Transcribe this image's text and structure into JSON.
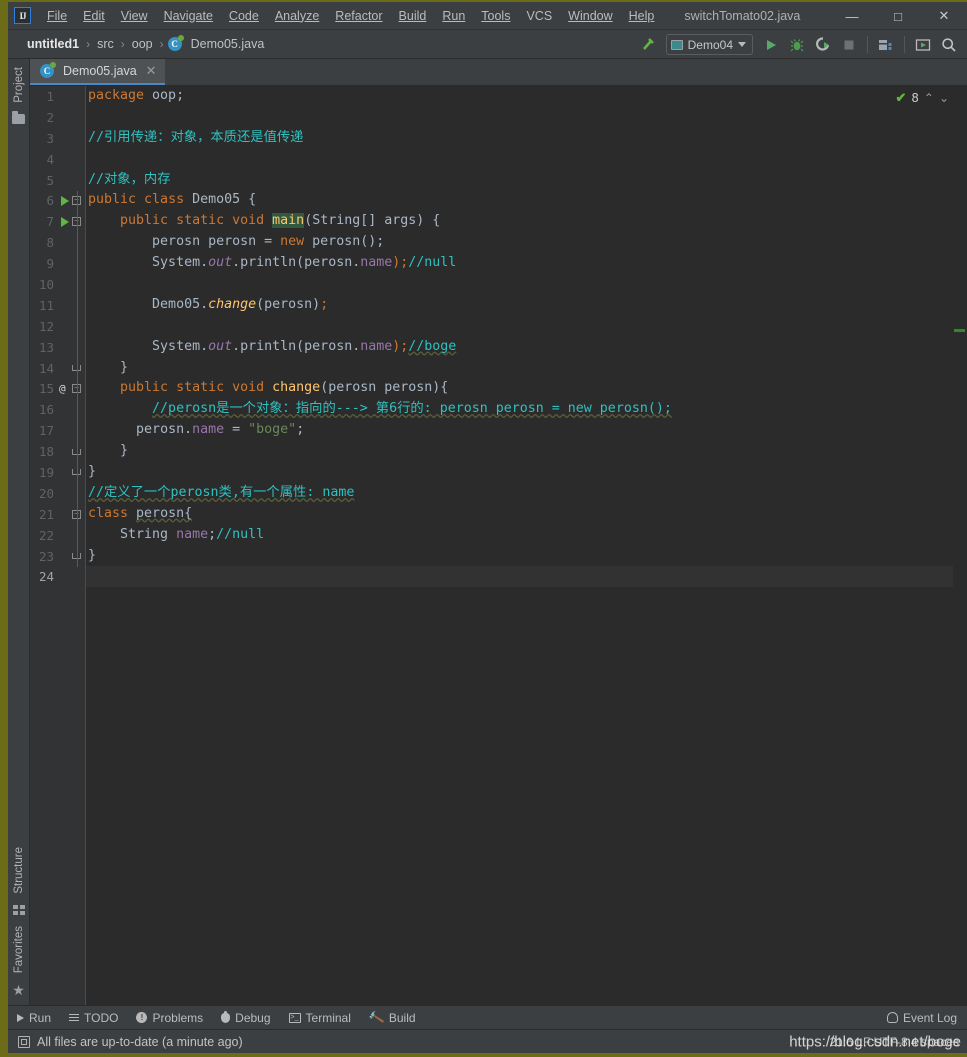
{
  "window": {
    "title": "switchTomato02.java",
    "logo_text": "IJ",
    "minimize": "—",
    "maximize": "□",
    "close": "✕"
  },
  "menu": [
    {
      "label": "File",
      "mnemonic": "F"
    },
    {
      "label": "Edit",
      "mnemonic": "E"
    },
    {
      "label": "View",
      "mnemonic": "V"
    },
    {
      "label": "Navigate",
      "mnemonic": "N"
    },
    {
      "label": "Code",
      "mnemonic": "C"
    },
    {
      "label": "Analyze",
      "mnemonic": "z"
    },
    {
      "label": "Refactor",
      "mnemonic": "R"
    },
    {
      "label": "Build",
      "mnemonic": "B"
    },
    {
      "label": "Run",
      "mnemonic": "u"
    },
    {
      "label": "Tools",
      "mnemonic": "T"
    },
    {
      "label": "VCS",
      "mnemonic": ""
    },
    {
      "label": "Window",
      "mnemonic": "W"
    },
    {
      "label": "Help",
      "mnemonic": "H"
    }
  ],
  "breadcrumb": {
    "items": [
      "untitled1",
      "src",
      "oop",
      "Demo05.java"
    ],
    "separator": "›",
    "file_icon": "class-icon",
    "class_letter": "C"
  },
  "toolbar": {
    "build_icon": "hammer-icon",
    "run_config": "Demo04",
    "run_icon": "run-icon",
    "debug_icon": "debug-icon",
    "coverage_icon": "run-with-coverage-icon",
    "stop_icon": "stop-icon",
    "project_structure_icon": "project-structure-icon",
    "updates_icon": "updates-icon",
    "search_icon": "search-everywhere-icon"
  },
  "left_strip": {
    "top": [
      {
        "label": "Project",
        "icon": "folder-icon"
      }
    ],
    "bottom": [
      {
        "label": "Structure",
        "icon": "structure-icon"
      },
      {
        "label": "Favorites",
        "icon": "star-icon"
      }
    ]
  },
  "tabs": [
    {
      "label": "Demo05.java",
      "icon": "class-icon",
      "close": "✕",
      "active": true
    }
  ],
  "inspection": {
    "status_icon": "check-ok-icon",
    "count": "8",
    "prev_icon": "⌃",
    "next_icon": "⌄"
  },
  "editor": {
    "current_line": 24,
    "lines": [
      {
        "n": 1,
        "gutter": {},
        "tokens": [
          {
            "t": "package ",
            "c": "kw"
          },
          {
            "t": "oop;",
            "c": ""
          }
        ],
        "indent": 0
      },
      {
        "n": 2,
        "gutter": {},
        "tokens": [],
        "indent": 0
      },
      {
        "n": 3,
        "gutter": {},
        "tokens": [
          {
            "t": "//引用传递：对象，本质还是值传递",
            "c": "cmt"
          }
        ],
        "indent": 0
      },
      {
        "n": 4,
        "gutter": {},
        "tokens": [],
        "indent": 0
      },
      {
        "n": 5,
        "gutter": {},
        "tokens": [
          {
            "t": "//对象，内存",
            "c": "cmt"
          }
        ],
        "indent": 0
      },
      {
        "n": 6,
        "gutter": {
          "run": true,
          "fold": "open"
        },
        "tokens": [
          {
            "t": "public ",
            "c": "kw"
          },
          {
            "t": "class ",
            "c": "kw"
          },
          {
            "t": "Demo05 {",
            "c": ""
          }
        ],
        "indent": 0
      },
      {
        "n": 7,
        "gutter": {
          "run": true,
          "fold": "open"
        },
        "tokens": [
          {
            "t": "public ",
            "c": "kw"
          },
          {
            "t": "static ",
            "c": "kw"
          },
          {
            "t": "void ",
            "c": "kw"
          },
          {
            "t": "main",
            "c": "hl"
          },
          {
            "t": "(String[] args) {",
            "c": ""
          }
        ],
        "indent": 1
      },
      {
        "n": 8,
        "gutter": {},
        "tokens": [
          {
            "t": "perosn perosn = ",
            "c": ""
          },
          {
            "t": "new ",
            "c": "kw"
          },
          {
            "t": "perosn();",
            "c": ""
          }
        ],
        "indent": 2
      },
      {
        "n": 9,
        "gutter": {},
        "tokens": [
          {
            "t": "System.",
            "c": ""
          },
          {
            "t": "out",
            "c": "sfld"
          },
          {
            "t": ".println(perosn.",
            "c": ""
          },
          {
            "t": "name",
            "c": "fld"
          },
          {
            "t": ");",
            "c": "kw"
          },
          {
            "t": "//null",
            "c": "cmt"
          }
        ],
        "indent": 2
      },
      {
        "n": 10,
        "gutter": {},
        "tokens": [],
        "indent": 0
      },
      {
        "n": 11,
        "gutter": {},
        "tokens": [
          {
            "t": "Demo05.",
            "c": ""
          },
          {
            "t": "change",
            "c": "smth"
          },
          {
            "t": "(perosn)",
            "c": ""
          },
          {
            "t": ";",
            "c": "kw"
          }
        ],
        "indent": 2
      },
      {
        "n": 12,
        "gutter": {},
        "tokens": [],
        "indent": 0
      },
      {
        "n": 13,
        "gutter": {},
        "tokens": [
          {
            "t": "System.",
            "c": ""
          },
          {
            "t": "out",
            "c": "sfld"
          },
          {
            "t": ".println(perosn.",
            "c": ""
          },
          {
            "t": "name",
            "c": "fld"
          },
          {
            "t": ");",
            "c": "kw"
          },
          {
            "t": "//boge",
            "c": "cmt-u"
          }
        ],
        "indent": 2
      },
      {
        "n": 14,
        "gutter": {
          "fold": "end"
        },
        "tokens": [
          {
            "t": "}",
            "c": ""
          }
        ],
        "indent": 1
      },
      {
        "n": 15,
        "gutter": {
          "at": "@",
          "fold": "open"
        },
        "tokens": [
          {
            "t": "public ",
            "c": "kw"
          },
          {
            "t": "static ",
            "c": "kw"
          },
          {
            "t": "void ",
            "c": "kw"
          },
          {
            "t": "change",
            "c": "mth"
          },
          {
            "t": "(perosn perosn){",
            "c": ""
          }
        ],
        "indent": 1
      },
      {
        "n": 16,
        "gutter": {},
        "tokens": [
          {
            "t": "//perosn是一个对象：指向的---> 第6行的: perosn perosn = new perosn();",
            "c": "cmt-u"
          }
        ],
        "indent": 2
      },
      {
        "n": 17,
        "gutter": {},
        "tokens": [
          {
            "t": "perosn.",
            "c": ""
          },
          {
            "t": "name",
            "c": "fld"
          },
          {
            "t": " = ",
            "c": ""
          },
          {
            "t": "\"boge\"",
            "c": "str"
          },
          {
            "t": ";",
            "c": ""
          }
        ],
        "indent": 1.5
      },
      {
        "n": 18,
        "gutter": {
          "fold": "end"
        },
        "tokens": [
          {
            "t": "}",
            "c": ""
          }
        ],
        "indent": 1
      },
      {
        "n": 19,
        "gutter": {
          "fold": "end"
        },
        "tokens": [
          {
            "t": "}",
            "c": ""
          }
        ],
        "indent": 0
      },
      {
        "n": 20,
        "gutter": {},
        "tokens": [
          {
            "t": "//定义了一个perosn类,有一个属性: name",
            "c": "cmt-u"
          }
        ],
        "indent": 0
      },
      {
        "n": 21,
        "gutter": {
          "fold": "open"
        },
        "tokens": [
          {
            "t": "class ",
            "c": "kw"
          },
          {
            "t": "perosn{",
            "c": "typo"
          }
        ],
        "indent": 0
      },
      {
        "n": 22,
        "gutter": {},
        "tokens": [
          {
            "t": "String ",
            "c": ""
          },
          {
            "t": "name",
            "c": "fld"
          },
          {
            "t": ";",
            "c": ""
          },
          {
            "t": "//null",
            "c": "cmt"
          }
        ],
        "indent": 1
      },
      {
        "n": 23,
        "gutter": {
          "fold": "end"
        },
        "tokens": [
          {
            "t": "}",
            "c": ""
          }
        ],
        "indent": 0
      },
      {
        "n": 24,
        "gutter": {},
        "tokens": [],
        "indent": 0
      }
    ]
  },
  "tool_windows": [
    {
      "label": "Run",
      "icon": "run-icon"
    },
    {
      "label": "TODO",
      "icon": "todo-icon"
    },
    {
      "label": "Problems",
      "icon": "problems-icon"
    },
    {
      "label": "Debug",
      "icon": "debug-icon"
    },
    {
      "label": "Terminal",
      "icon": "terminal-icon"
    },
    {
      "label": "Build",
      "icon": "build-icon"
    }
  ],
  "event_log": {
    "label": "Event Log",
    "icon": "event-log-icon"
  },
  "status": {
    "message": "All files are up-to-date (a minute ago)",
    "icon": "sync-icon",
    "right_text": "21:6  LF  UTF-8  4 spaces",
    "watermark": "https://blog.csdn.net/boge"
  },
  "colors": {
    "accent_blue": "#4a88c7",
    "keyword_orange": "#cc7832",
    "comment_cyan": "#30c0c0",
    "string_green": "#6a8759",
    "field_purple": "#9876aa",
    "method_yellow": "#ffc66d",
    "run_green": "#62b543",
    "editor_bg": "#2b2b2b",
    "chrome_bg": "#3c3f41"
  }
}
